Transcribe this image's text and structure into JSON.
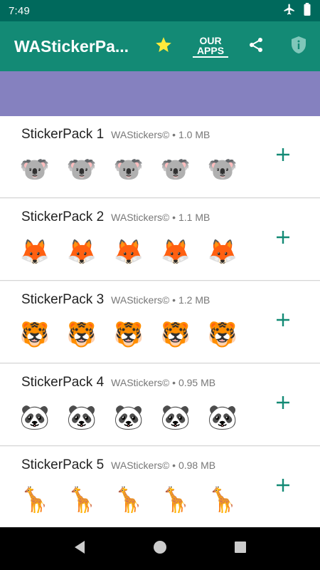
{
  "status_bar": {
    "time": "7:49"
  },
  "app_bar": {
    "title": "WAStickerPa...",
    "our_apps_line1": "OUR",
    "our_apps_line2": "APPS"
  },
  "packs": [
    {
      "name": "StickerPack 1",
      "meta": "WAStickers© • 1.0 MB",
      "stickers": [
        "🐨",
        "🐨",
        "🐨",
        "🐨",
        "🐨"
      ]
    },
    {
      "name": "StickerPack 2",
      "meta": "WAStickers© • 1.1 MB",
      "stickers": [
        "🦊",
        "🦊",
        "🦊",
        "🦊",
        "🦊"
      ]
    },
    {
      "name": "StickerPack 3",
      "meta": "WAStickers© • 1.2 MB",
      "stickers": [
        "🐯",
        "🐯",
        "🐯",
        "🐯",
        "🐯"
      ]
    },
    {
      "name": "StickerPack 4",
      "meta": "WAStickers© • 0.95 MB",
      "stickers": [
        "🐼",
        "🐼",
        "🐼",
        "🐼",
        "🐼"
      ]
    },
    {
      "name": "StickerPack 5",
      "meta": "WAStickers© • 0.98 MB",
      "stickers": [
        "🦒",
        "🦒",
        "🦒",
        "🦒",
        "🦒"
      ]
    }
  ],
  "colors": {
    "status_bar": "#00695c",
    "app_bar": "#138a75",
    "banner": "#8581bf",
    "accent": "#138a75",
    "star": "#ffeb3b"
  },
  "icons": {
    "favorite": "star-icon",
    "share": "share-icon",
    "privacy": "shield-info-icon",
    "add": "plus-icon"
  }
}
